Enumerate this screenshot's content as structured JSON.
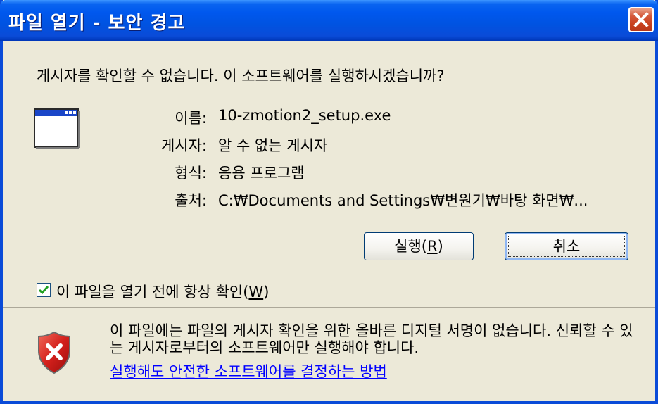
{
  "window": {
    "title": "파일 열기 - 보안 경고"
  },
  "question": "게시자를 확인할 수 없습니다. 이 소프트웨어를 실행하시겠습니까?",
  "info": {
    "name_label": "이름:",
    "name_value": "10-zmotion2_setup.exe",
    "publisher_label": "게시자:",
    "publisher_value": "알 수 없는 게시자",
    "type_label": "형식:",
    "type_value": "응용 프로그램",
    "from_label": "출처:",
    "from_value": "C:₩Documents and Settings₩변원기₩바탕 화면₩..."
  },
  "buttons": {
    "run_prefix": "실행(",
    "run_mnemonic": "R",
    "run_suffix": ")",
    "cancel": "취소"
  },
  "checkbox": {
    "checked": true,
    "label_prefix": "이 파일을 열기 전에 항상 확인(",
    "label_mnemonic": "W",
    "label_suffix": ")"
  },
  "warning": {
    "text": "이 파일에는 파일의 게시자 확인을 위한 올바른 디지털 서명이 없습니다. 신뢰할 수 있는 게시자로부터의 소프트웨어만 실행해야 합니다.",
    "link": "실행해도 안전한 소프트웨어를 결정하는 방법"
  },
  "icons": {
    "close": "close-icon",
    "application": "application-window-icon",
    "check": "checkmark-icon",
    "shield": "security-shield-icon"
  },
  "colors": {
    "titlebar": "#0053e1",
    "close_button": "#c8401e",
    "dialog_background": "#ece9d8",
    "link": "#0000ff",
    "shield_red": "#d4201c"
  }
}
